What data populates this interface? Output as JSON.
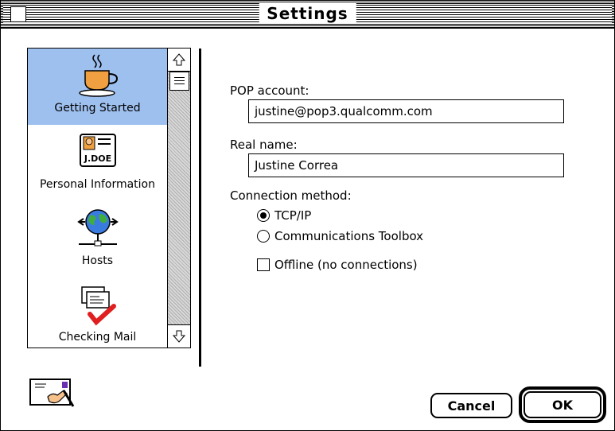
{
  "window": {
    "title": "Settings"
  },
  "sidebar": {
    "items": [
      {
        "label": "Getting Started",
        "icon": "coffee-cup-icon",
        "selected": true
      },
      {
        "label": "Personal Information",
        "icon": "id-card-icon",
        "badge": "J.DOE",
        "selected": false
      },
      {
        "label": "Hosts",
        "icon": "network-globe-icon",
        "selected": false
      },
      {
        "label": "Checking Mail",
        "icon": "mail-check-icon",
        "selected": false
      }
    ]
  },
  "form": {
    "pop_account": {
      "label": "POP account:",
      "value": "justine@pop3.qualcomm.com"
    },
    "real_name": {
      "label": "Real name:",
      "value": "Justine Correa"
    },
    "connection_method": {
      "label": "Connection method:",
      "options": [
        {
          "label": "TCP/IP",
          "selected": true
        },
        {
          "label": "Communications Toolbox",
          "selected": false
        }
      ]
    },
    "offline": {
      "label": "Offline (no connections)",
      "checked": false
    }
  },
  "buttons": {
    "cancel": "Cancel",
    "ok": "OK"
  },
  "colors": {
    "selection": "#9ec0ef",
    "accent_red": "#e02020"
  }
}
